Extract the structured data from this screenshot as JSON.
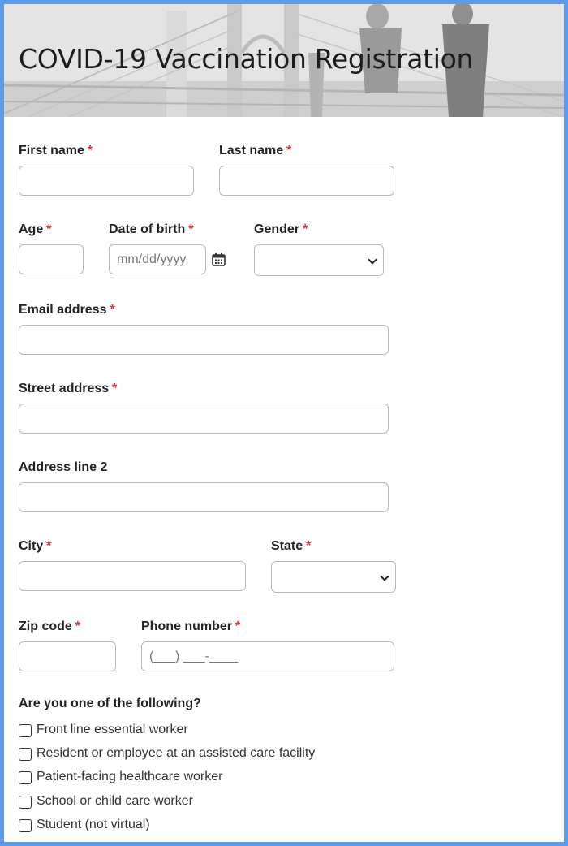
{
  "form": {
    "title": "COVID-19 Vaccination Registration",
    "required_marker": "*",
    "fields": {
      "first_name": {
        "label": "First name",
        "value": ""
      },
      "last_name": {
        "label": "Last name",
        "value": ""
      },
      "age": {
        "label": "Age",
        "value": ""
      },
      "dob": {
        "label": "Date of birth",
        "placeholder": "mm/dd/yyyy"
      },
      "gender": {
        "label": "Gender",
        "selected": ""
      },
      "email": {
        "label": "Email address",
        "value": ""
      },
      "street": {
        "label": "Street address",
        "value": ""
      },
      "address2": {
        "label": "Address line 2",
        "value": ""
      },
      "city": {
        "label": "City",
        "value": ""
      },
      "state": {
        "label": "State",
        "selected": ""
      },
      "zip": {
        "label": "Zip code",
        "value": ""
      },
      "phone": {
        "label": "Phone number",
        "placeholder": "(___) ___-____"
      }
    },
    "question": "Are you one of the following?",
    "options": [
      {
        "label": "Front line essential worker",
        "checked": false
      },
      {
        "label": "Resident or employee at an assisted care facility",
        "checked": false
      },
      {
        "label": "Patient-facing healthcare worker",
        "checked": false
      },
      {
        "label": "School or child care worker",
        "checked": false
      },
      {
        "label": "Student (not virtual)",
        "checked": false
      }
    ]
  },
  "colors": {
    "frame_border": "#5b9bea",
    "required": "#e0322f"
  }
}
